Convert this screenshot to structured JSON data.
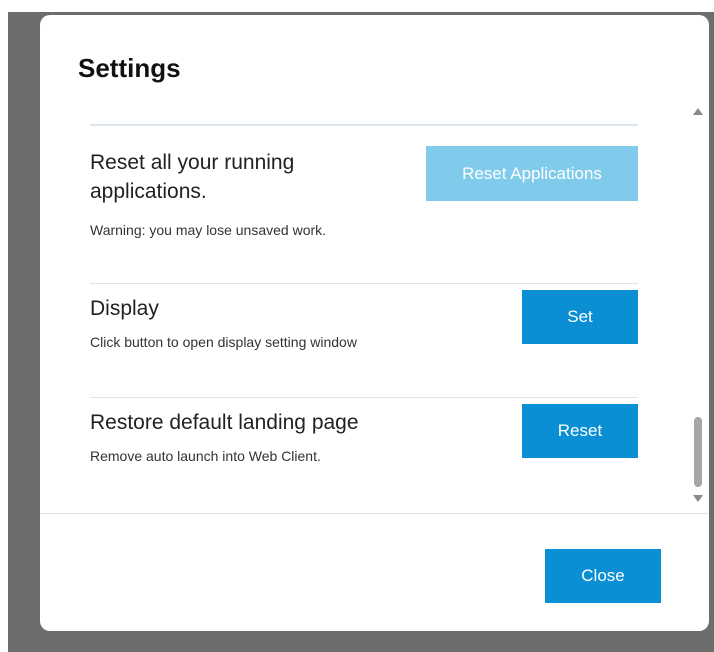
{
  "dialog": {
    "title": "Settings",
    "close_label": "Close"
  },
  "settings": [
    {
      "title": "Reset all your running applications.",
      "description": "Warning: you may lose unsaved work.",
      "button_label": "Reset Applications",
      "button_disabled": true
    },
    {
      "title": "Display",
      "description": "Click button to open display setting window",
      "button_label": "Set"
    },
    {
      "title": "Restore default landing page",
      "description": "Remove auto launch into Web Client.",
      "button_label": "Reset"
    }
  ],
  "colors": {
    "accent": "#0a8fd4",
    "accent_disabled": "#80cbec",
    "overlay": "#6d6d6d"
  }
}
